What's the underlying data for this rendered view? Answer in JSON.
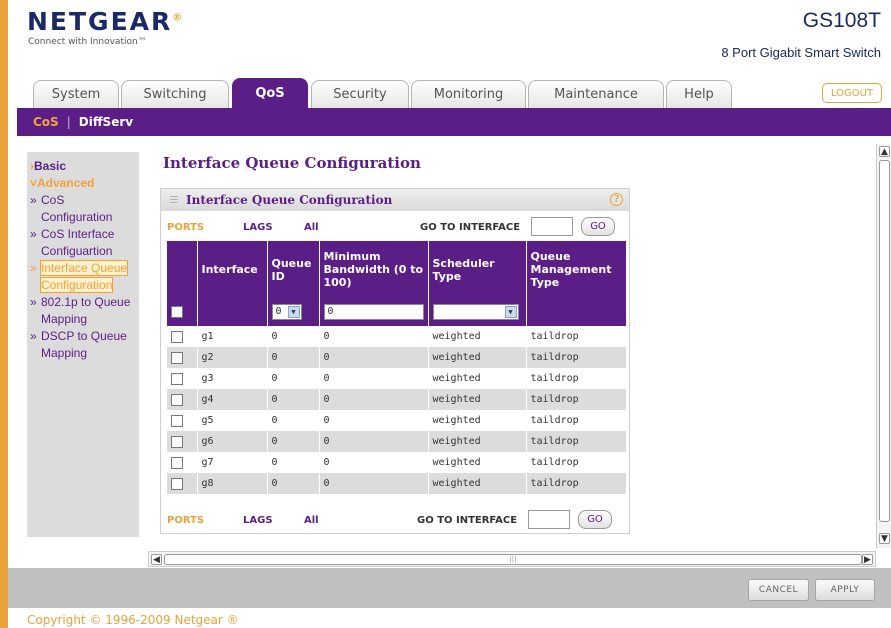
{
  "header": {
    "logo": "NETGEAR",
    "logo_mark": "®",
    "tagline": "Connect with Innovation™",
    "model": "GS108T",
    "model_desc": "8 Port Gigabit Smart Switch",
    "logout": "LOGOUT"
  },
  "tabs": [
    {
      "label": "System"
    },
    {
      "label": "Switching"
    },
    {
      "label": "QoS",
      "active": true
    },
    {
      "label": "Security"
    },
    {
      "label": "Monitoring"
    },
    {
      "label": "Maintenance"
    },
    {
      "label": "Help"
    }
  ],
  "subnav": {
    "cos": "CoS",
    "sep": "|",
    "diffserv": "DiffServ"
  },
  "sidebar": {
    "basic": "Basic",
    "advanced": "Advanced",
    "items": [
      {
        "label": "CoS Configuration"
      },
      {
        "label": "CoS Interface Configuartion"
      },
      {
        "label": "Interface Queue Configuration",
        "current": true
      },
      {
        "label": "802.1p to Queue Mapping"
      },
      {
        "label": "DSCP to Queue Mapping"
      }
    ]
  },
  "main": {
    "title": "Interface Queue Configuration",
    "panel_title": "Interface Queue Configuration",
    "help": "?",
    "pager": {
      "ports": "PORTS",
      "lags": "LAGS",
      "all": "All",
      "goto": "GO TO INTERFACE",
      "go": "GO"
    },
    "columns": [
      "Interface",
      "Queue ID",
      "Minimum Bandwidth (0 to 100)",
      "Scheduler Type",
      "Queue Management Type"
    ],
    "edit_row": {
      "queue_id": "0",
      "min_bw": "0",
      "scheduler": ""
    },
    "rows": [
      {
        "iface": "g1",
        "queue": "0",
        "bw": "0",
        "sched": "weighted",
        "mgmt": "taildrop"
      },
      {
        "iface": "g2",
        "queue": "0",
        "bw": "0",
        "sched": "weighted",
        "mgmt": "taildrop"
      },
      {
        "iface": "g3",
        "queue": "0",
        "bw": "0",
        "sched": "weighted",
        "mgmt": "taildrop"
      },
      {
        "iface": "g4",
        "queue": "0",
        "bw": "0",
        "sched": "weighted",
        "mgmt": "taildrop"
      },
      {
        "iface": "g5",
        "queue": "0",
        "bw": "0",
        "sched": "weighted",
        "mgmt": "taildrop"
      },
      {
        "iface": "g6",
        "queue": "0",
        "bw": "0",
        "sched": "weighted",
        "mgmt": "taildrop"
      },
      {
        "iface": "g7",
        "queue": "0",
        "bw": "0",
        "sched": "weighted",
        "mgmt": "taildrop"
      },
      {
        "iface": "g8",
        "queue": "0",
        "bw": "0",
        "sched": "weighted",
        "mgmt": "taildrop"
      }
    ]
  },
  "footer": {
    "cancel": "CANCEL",
    "apply": "APPLY",
    "copyright": "Copyright © 1996-2009 Netgear ®"
  },
  "colors": {
    "brand_purple": "#5a1e86",
    "accent_orange": "#e8a33a",
    "navy": "#1b2a66"
  }
}
